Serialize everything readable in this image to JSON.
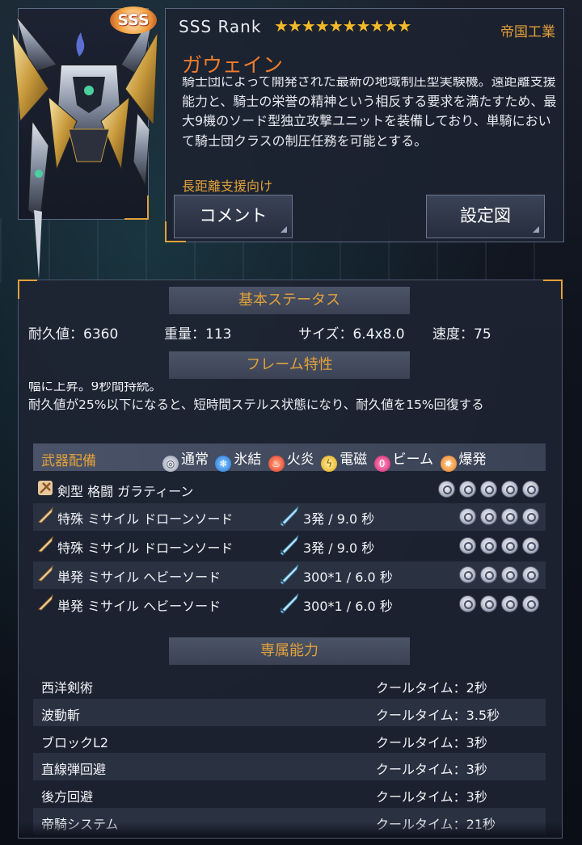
{
  "unit": {
    "rank_badge": "SSS",
    "rank_text": "SSS  Rank",
    "stars": "★★★★★★★★★★",
    "faction": "帝国工業",
    "name": "ガウェイン",
    "description": "騎士団によって開発された最新の地域制圧型実験機。遠距離支援能力と、騎士の栄誉の精神という相反する要求を満たすため、最大9機のソード型独立攻撃ユニットを装備しており、単騎において騎士団クラスの制圧任務を可能とする。",
    "tag": "長距離支援向け"
  },
  "buttons": {
    "comment": "コメント",
    "setting": "設定図"
  },
  "basic_status": {
    "header": "基本ステータス",
    "durability": "耐久値：6360",
    "weight": "重量：113",
    "size": "サイズ：6.4x8.0",
    "speed": "速度：75"
  },
  "frame_trait": {
    "header": "フレーム特性",
    "line1": "幅に上昇。9秒間持続。",
    "line2": "耐久値が25%以下になると、短時間ステルス状態になり、耐久値を15%回復する"
  },
  "weapons": {
    "header": "武器配備",
    "legend": {
      "normal": "通常",
      "freeze": "氷結",
      "fire": "火炎",
      "elec": "電磁",
      "beam": "ビーム",
      "burst": "爆発"
    },
    "rows": [
      {
        "name": "剣型 格闘 ガラティーン",
        "stat": ""
      },
      {
        "name": "特殊 ミサイル ドローンソード",
        "stat": "3発  / 9.0 秒"
      },
      {
        "name": "特殊 ミサイル ドローンソード",
        "stat": "3発  / 9.0 秒"
      },
      {
        "name": "単発 ミサイル ヘビーソード",
        "stat": "300*1 / 6.0 秒"
      },
      {
        "name": "単発 ミサイル ヘビーソード",
        "stat": "300*1 / 6.0 秒"
      }
    ]
  },
  "abilities": {
    "header": "専属能力",
    "rows": [
      {
        "name": "西洋剣術",
        "cooldown": "クールタイム：2秒"
      },
      {
        "name": "波動斬",
        "cooldown": "クールタイム：3.5秒"
      },
      {
        "name": "ブロックL2",
        "cooldown": "クールタイム：3秒"
      },
      {
        "name": "直線弾回避",
        "cooldown": "クールタイム：3秒"
      },
      {
        "name": "後方回避",
        "cooldown": "クールタイム：3秒"
      },
      {
        "name": "帝騎システム",
        "cooldown": "クールタイム：21秒"
      }
    ]
  },
  "colors": {
    "accent": "#e2a13a",
    "name": "#ef7d2d",
    "star": "#f3b928"
  }
}
